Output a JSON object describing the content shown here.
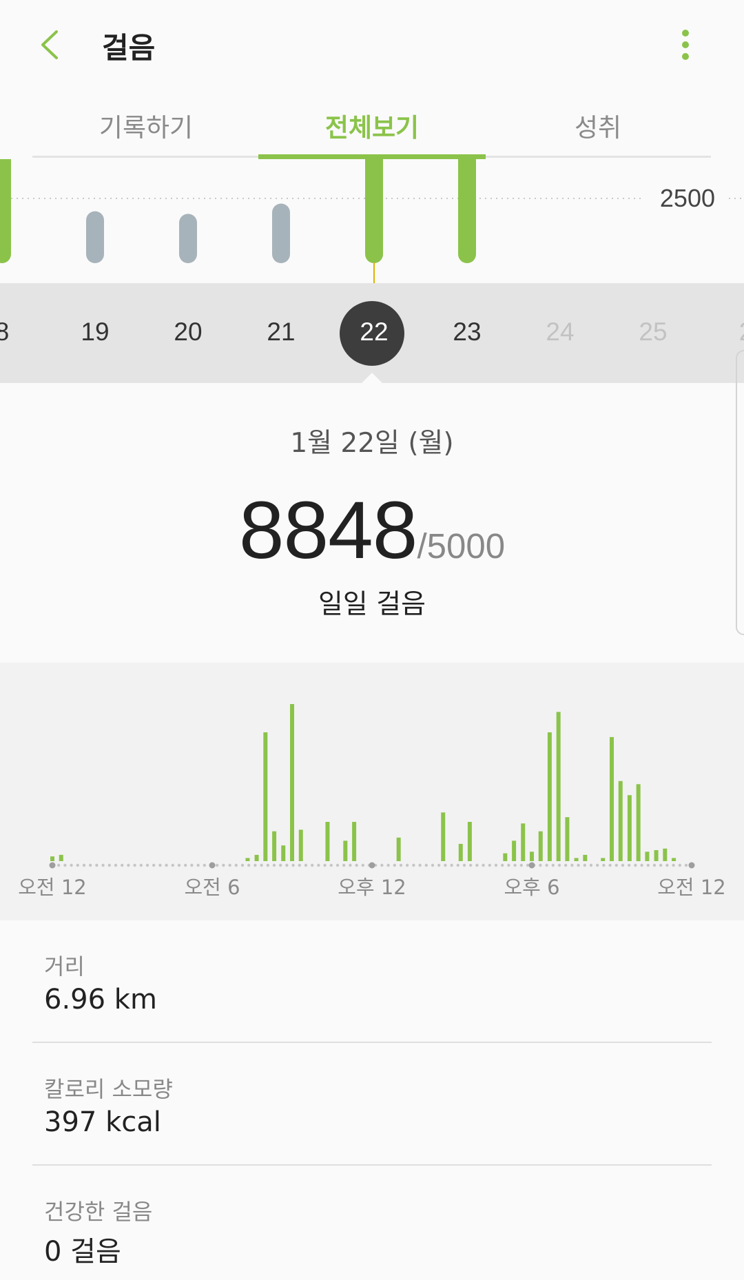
{
  "header": {
    "title": "걸음"
  },
  "tabs": [
    {
      "label": "기록하기",
      "active": false
    },
    {
      "label": "전체보기",
      "active": true
    },
    {
      "label": "성취",
      "active": false
    }
  ],
  "colors": {
    "accent": "#8bc34a",
    "inactive_bar": "#a7b3ba",
    "dark_circle": "#3d3d3d"
  },
  "daily_chart": {
    "goal_line_label": "2500",
    "days": [
      {
        "label": "8",
        "steps": 5600,
        "goal_met": true
      },
      {
        "label": "19",
        "steps": 1650,
        "goal_met": false
      },
      {
        "label": "20",
        "steps": 1550,
        "goal_met": false
      },
      {
        "label": "21",
        "steps": 1950,
        "goal_met": false
      },
      {
        "label": "22",
        "steps": 8848,
        "goal_met": true,
        "selected": true
      },
      {
        "label": "23",
        "steps": 5300,
        "goal_met": true
      },
      {
        "label": "24",
        "future": true
      },
      {
        "label": "25",
        "future": true
      },
      {
        "label": "2",
        "future": true
      }
    ]
  },
  "summary": {
    "date": "1월 22일 (월)",
    "steps": "8848",
    "goal": "/5000",
    "label": "일일 걸음"
  },
  "chart_data": {
    "type": "bar",
    "x_tick_labels": [
      "오전 12",
      "오전 6",
      "오후 12",
      "오후 6",
      "오전 12"
    ],
    "bins_per_hour": 3,
    "values": [
      3,
      3,
      0,
      0,
      0,
      0,
      0,
      0,
      0,
      0,
      0,
      0,
      0,
      0,
      0,
      0,
      0,
      0,
      0,
      0,
      0,
      0,
      0,
      0,
      0,
      0,
      0,
      0,
      0,
      0,
      0,
      0,
      0,
      0,
      0,
      0,
      0,
      0,
      0,
      0,
      0,
      0,
      0,
      0,
      0,
      0,
      0,
      0,
      0,
      0,
      0,
      0,
      0,
      0,
      0,
      0,
      0,
      0,
      0,
      0,
      0,
      0,
      0,
      0,
      0,
      0,
      0,
      0,
      0,
      0,
      0,
      0,
      0,
      0,
      0,
      0,
      0,
      0,
      0,
      0,
      0,
      0,
      0,
      0,
      0,
      0,
      0,
      0,
      0,
      0,
      0,
      0,
      0,
      0,
      0,
      0,
      0,
      0,
      0,
      0,
      0,
      0,
      0,
      0,
      0,
      0,
      0,
      0,
      0,
      0,
      0,
      0,
      0,
      0,
      0,
      0,
      0,
      0,
      0,
      0,
      0,
      0,
      0,
      0,
      0,
      0,
      0,
      0,
      0,
      0,
      0,
      0,
      0,
      0,
      0,
      0,
      0,
      0,
      0,
      0,
      0,
      0,
      0,
      0
    ],
    "bars": [
      {
        "t": 0.0,
        "v": 3
      },
      {
        "t": 0.33,
        "v": 4
      },
      {
        "t": 7.33,
        "v": 2
      },
      {
        "t": 7.67,
        "v": 4
      },
      {
        "t": 8.0,
        "v": 82
      },
      {
        "t": 8.33,
        "v": 19
      },
      {
        "t": 8.67,
        "v": 10
      },
      {
        "t": 9.0,
        "v": 100
      },
      {
        "t": 9.33,
        "v": 20
      },
      {
        "t": 10.33,
        "v": 25
      },
      {
        "t": 11.0,
        "v": 13
      },
      {
        "t": 11.33,
        "v": 25
      },
      {
        "t": 13.0,
        "v": 15
      },
      {
        "t": 14.67,
        "v": 31
      },
      {
        "t": 15.33,
        "v": 11
      },
      {
        "t": 15.67,
        "v": 25
      },
      {
        "t": 17.0,
        "v": 5
      },
      {
        "t": 17.33,
        "v": 13
      },
      {
        "t": 17.67,
        "v": 24
      },
      {
        "t": 18.0,
        "v": 6
      },
      {
        "t": 18.33,
        "v": 19
      },
      {
        "t": 18.67,
        "v": 82
      },
      {
        "t": 19.0,
        "v": 95
      },
      {
        "t": 19.33,
        "v": 28
      },
      {
        "t": 19.67,
        "v": 2
      },
      {
        "t": 20.0,
        "v": 4
      },
      {
        "t": 20.67,
        "v": 2
      },
      {
        "t": 21.0,
        "v": 79
      },
      {
        "t": 21.33,
        "v": 51
      },
      {
        "t": 21.67,
        "v": 42
      },
      {
        "t": 22.0,
        "v": 49
      },
      {
        "t": 22.33,
        "v": 6
      },
      {
        "t": 22.67,
        "v": 7
      },
      {
        "t": 23.0,
        "v": 8
      },
      {
        "t": 23.33,
        "v": 2
      }
    ],
    "xlim": [
      0,
      24
    ]
  },
  "stats": [
    {
      "label": "거리",
      "value": "6.96 km"
    },
    {
      "label": "칼로리 소모량",
      "value": "397 kcal"
    },
    {
      "label": "건강한 걸음",
      "value": "0 걸음"
    }
  ]
}
